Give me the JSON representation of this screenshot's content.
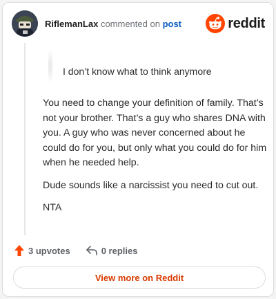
{
  "header": {
    "username": "RiflemanLax",
    "commented_on": "commented on",
    "post_link": "post",
    "brand": "reddit",
    "brand_color": "#ff4500"
  },
  "comment": {
    "quote": "I don’t know what to think anymore",
    "paragraphs": [
      "You need to change your definition of family. That’s not your brother. That’s a guy who shares DNA with you. A guy who was never concerned about he could do for you, but only what you could do for him when he needed help.",
      "Dude sounds like a narcissist you need to cut out.",
      "NTA"
    ]
  },
  "actions": {
    "upvotes": "3 upvotes",
    "replies": "0 replies",
    "upvote_icon": "upvote-arrow-icon",
    "reply_icon": "reply-arrow-icon",
    "upvote_color": "#ff4500"
  },
  "footer": {
    "view_more": "View more on Reddit"
  }
}
